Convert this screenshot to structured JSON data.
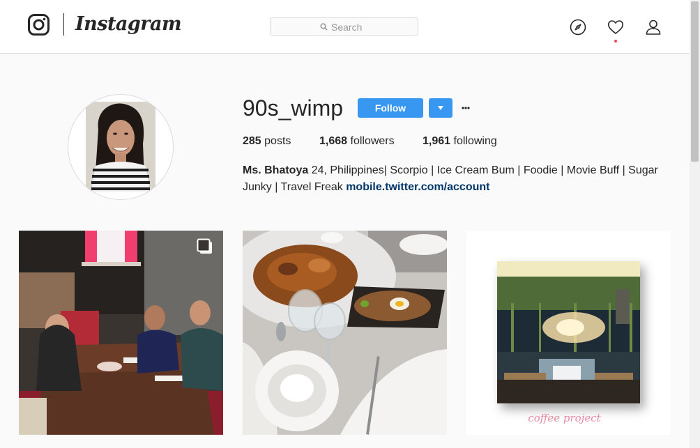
{
  "header": {
    "logo_text": "Instagram",
    "search_placeholder": "Search",
    "nav": {
      "explore_icon": "compass-icon",
      "activity_icon": "heart-icon",
      "profile_icon": "person-icon"
    },
    "activity_has_notification": true
  },
  "profile": {
    "username": "90s_wimp",
    "follow_label": "Follow",
    "more_label": "···",
    "stats": {
      "posts_count": "285",
      "posts_label": "posts",
      "followers_count": "1,668",
      "followers_label": "followers",
      "following_count": "1,961",
      "following_label": "following"
    },
    "bio": {
      "name": "Ms. Bhatoya",
      "text": " 24, Philippines| Scorpio | Ice Cream Bum | Foodie | Movie Buff | Sugar Junky | Travel Freak ",
      "link": "mobile.twitter.com/account"
    }
  },
  "posts": [
    {
      "image": "group-photo-at-restaurant-table",
      "multiple": true
    },
    {
      "image": "sizzling-plate-and-rice-meal",
      "multiple": false
    },
    {
      "image": "cafe-interior-framed",
      "caption": "coffee project",
      "multiple": false
    }
  ],
  "colors": {
    "accent": "#3897f0",
    "link": "#003569",
    "notification": "#ed4956",
    "caption_pink": "#e58aa0"
  }
}
